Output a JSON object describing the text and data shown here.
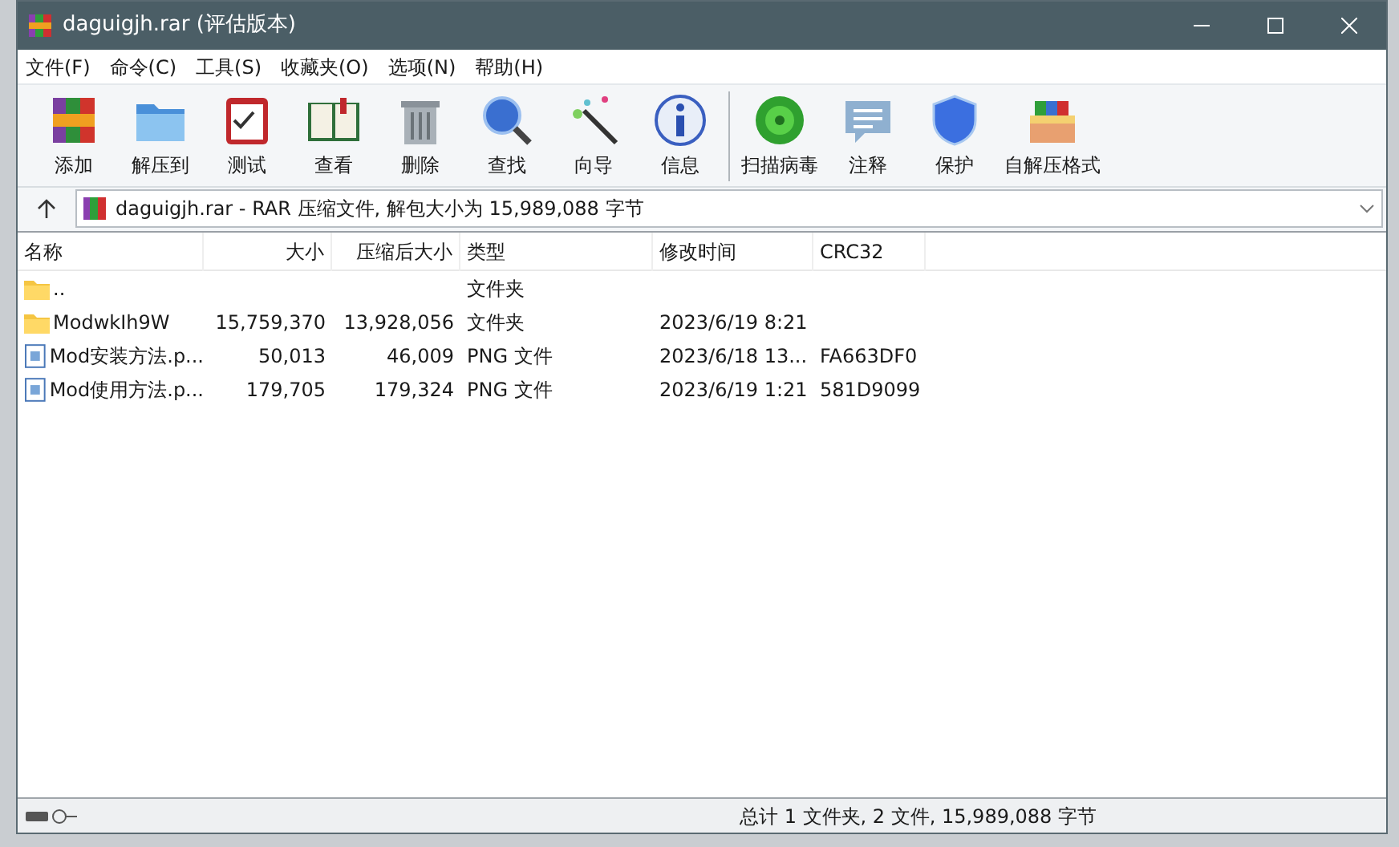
{
  "window": {
    "title": "daguigjh.rar (评估版本)"
  },
  "menu": [
    "文件(F)",
    "命令(C)",
    "工具(S)",
    "收藏夹(O)",
    "选项(N)",
    "帮助(H)"
  ],
  "toolbar": [
    {
      "kind": "add",
      "label": "添加"
    },
    {
      "kind": "extract",
      "label": "解压到"
    },
    {
      "kind": "test",
      "label": "测试"
    },
    {
      "kind": "view",
      "label": "查看"
    },
    {
      "kind": "delete",
      "label": "删除"
    },
    {
      "kind": "find",
      "label": "查找"
    },
    {
      "kind": "wizard",
      "label": "向导"
    },
    {
      "kind": "info",
      "label": "信息"
    },
    {
      "kind": "virus",
      "label": "扫描病毒"
    },
    {
      "kind": "comment",
      "label": "注释"
    },
    {
      "kind": "protect",
      "label": "保护"
    },
    {
      "kind": "sfx",
      "label": "自解压格式"
    }
  ],
  "address": {
    "path": "daguigjh.rar - RAR 压缩文件, 解包大小为 15,989,088 字节"
  },
  "table": {
    "columns": [
      "名称",
      "大小",
      "压缩后大小",
      "类型",
      "修改时间",
      "CRC32"
    ],
    "rows": [
      {
        "kind": "folder",
        "name": "..",
        "size": "",
        "packed": "",
        "type": "文件夹",
        "modified": "",
        "crc": ""
      },
      {
        "kind": "folder",
        "name": "ModwkIh9W",
        "size": "15,759,370",
        "packed": "13,928,056",
        "type": "文件夹",
        "modified": "2023/6/19 8:21",
        "crc": ""
      },
      {
        "kind": "file",
        "name": "Mod安装方法.p...",
        "size": "50,013",
        "packed": "46,009",
        "type": "PNG 文件",
        "modified": "2023/6/18 13...",
        "crc": "FA663DF0"
      },
      {
        "kind": "file",
        "name": "Mod使用方法.p...",
        "size": "179,705",
        "packed": "179,324",
        "type": "PNG 文件",
        "modified": "2023/6/19 1:21",
        "crc": "581D9099"
      }
    ]
  },
  "status_bar": {
    "text": "总计 1 文件夹, 2 文件, 15,989,088 字节"
  }
}
